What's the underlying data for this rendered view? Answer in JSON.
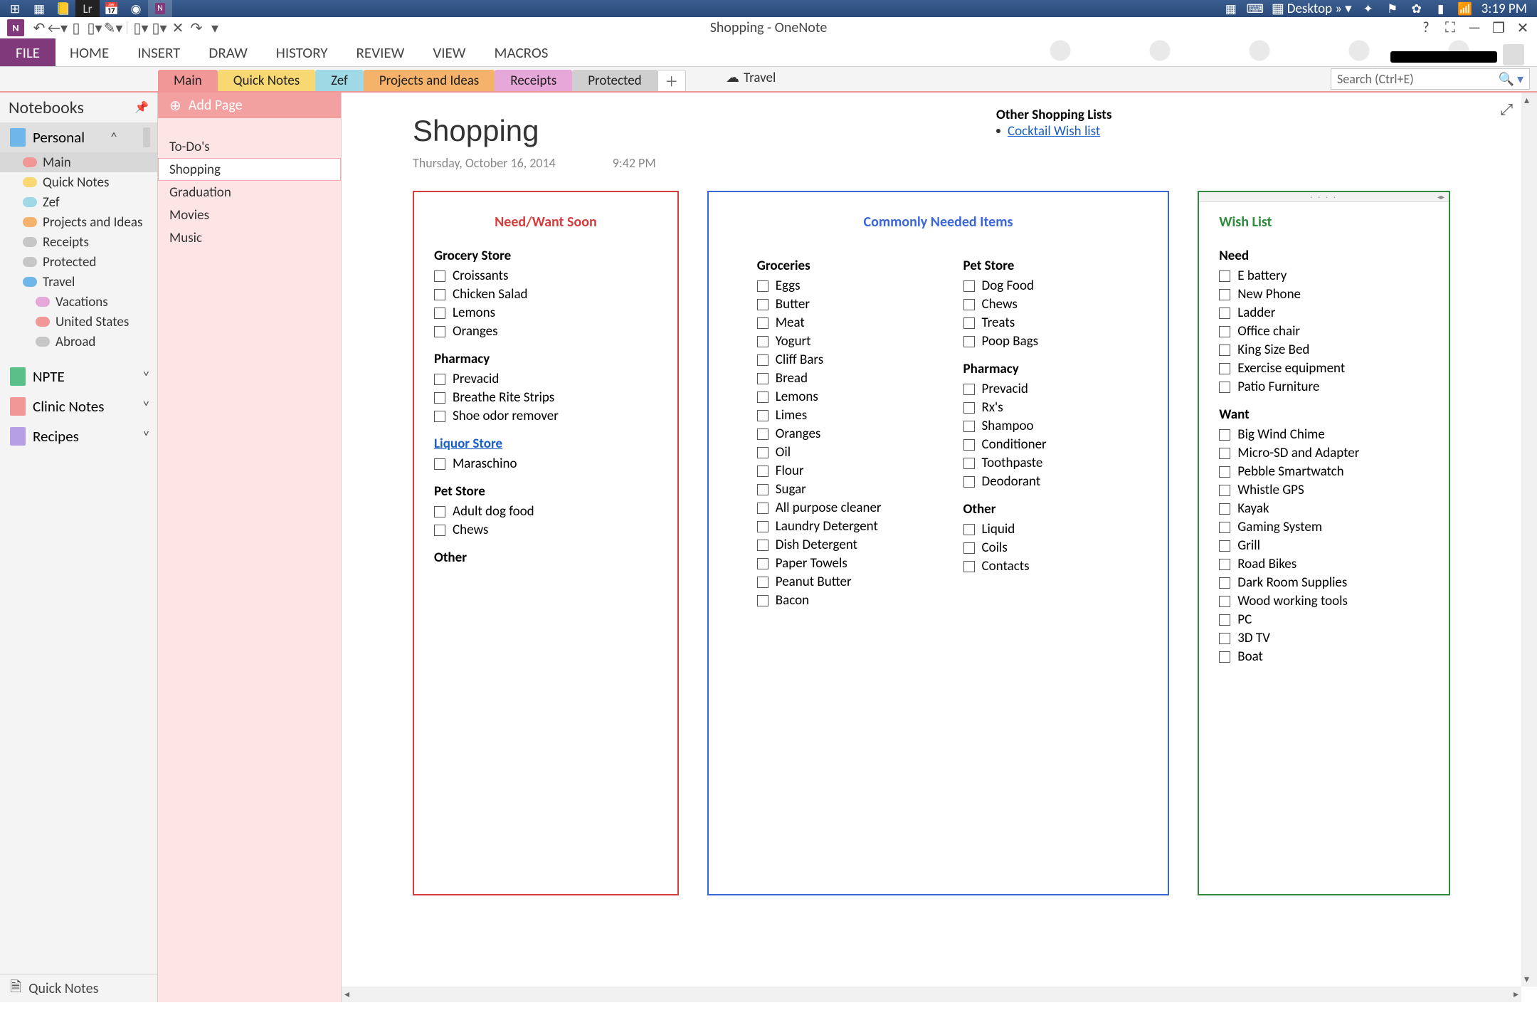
{
  "taskbar": {
    "desktop_label": "Desktop",
    "time": "3:19 PM"
  },
  "window": {
    "title": "Shopping - OneNote"
  },
  "ribbon": {
    "file": "FILE",
    "tabs": [
      "HOME",
      "INSERT",
      "DRAW",
      "HISTORY",
      "REVIEW",
      "VIEW",
      "MACROS"
    ]
  },
  "section_tabs": [
    {
      "label": "Main",
      "color": "#f29797"
    },
    {
      "label": "Quick Notes",
      "color": "#f7d873"
    },
    {
      "label": "Zef",
      "color": "#9fd9e6"
    },
    {
      "label": "Projects and Ideas",
      "color": "#f4b26b"
    },
    {
      "label": "Receipts",
      "color": "#e6a8d8"
    },
    {
      "label": "Protected",
      "color": "#cfcfcf"
    }
  ],
  "section_group_link": "Travel",
  "search": {
    "placeholder": "Search (Ctrl+E)"
  },
  "notebooks": {
    "header": "Notebooks",
    "books": [
      {
        "label": "Personal",
        "color": "#6fb7e8",
        "expanded": true,
        "selected": true,
        "sections": [
          {
            "label": "Main",
            "color": "#f29797",
            "selected": true
          },
          {
            "label": "Quick Notes",
            "color": "#f7d873"
          },
          {
            "label": "Zef",
            "color": "#9fd9e6"
          },
          {
            "label": "Projects and Ideas",
            "color": "#f4b26b"
          },
          {
            "label": "Receipts",
            "color": "#c6c6c6"
          },
          {
            "label": "Protected",
            "color": "#c6c6c6"
          },
          {
            "label": "Travel",
            "color": "#6fb7e8",
            "group": true
          },
          {
            "label": "Vacations",
            "color": "#e6a8d8",
            "sub": true
          },
          {
            "label": "United States",
            "color": "#f29797",
            "sub": true
          },
          {
            "label": "Abroad",
            "color": "#c6c6c6",
            "sub": true
          }
        ]
      },
      {
        "label": "NPTE",
        "color": "#5bbf8a"
      },
      {
        "label": "Clinic Notes",
        "color": "#f29797"
      },
      {
        "label": "Recipes",
        "color": "#b79fe6"
      }
    ],
    "footer": "Quick Notes"
  },
  "pages": {
    "add_label": "Add Page",
    "items": [
      "To-Do's",
      "Shopping",
      "Graduation",
      "Movies",
      "Music"
    ],
    "selected": "Shopping"
  },
  "page": {
    "title": "Shopping",
    "date": "Thursday, October 16, 2014",
    "time": "9:42 PM"
  },
  "other_lists": {
    "header": "Other Shopping Lists",
    "link": "Cocktail Wish list"
  },
  "box_red": {
    "title": "Need/Want Soon",
    "groups": [
      {
        "cat": "Grocery Store",
        "items": [
          "Croissants",
          "Chicken Salad",
          "Lemons",
          "Oranges"
        ]
      },
      {
        "cat": "Pharmacy",
        "items": [
          "Prevacid",
          "Breathe Rite Strips",
          "Shoe odor remover"
        ]
      },
      {
        "cat": "Liquor Store",
        "link": true,
        "items": [
          "Maraschino"
        ]
      },
      {
        "cat": "Pet Store",
        "items": [
          "Adult dog food",
          "Chews"
        ]
      },
      {
        "cat": "Other",
        "items": []
      }
    ]
  },
  "box_blue": {
    "title": "Commonly Needed Items",
    "left": [
      {
        "cat": "Groceries",
        "items": [
          "Eggs",
          "Butter",
          "Meat",
          "Yogurt",
          "Cliff Bars",
          "Bread",
          "Lemons",
          "Limes",
          "Oranges",
          "Oil",
          "Flour",
          "Sugar",
          "All purpose cleaner",
          "Laundry Detergent",
          "Dish Detergent",
          "Paper Towels",
          "Peanut Butter",
          "Bacon"
        ]
      }
    ],
    "right": [
      {
        "cat": "Pet Store",
        "items": [
          "Dog Food",
          "Chews",
          "Treats",
          "Poop Bags"
        ]
      },
      {
        "cat": "Pharmacy",
        "items": [
          "Prevacid",
          "Rx's",
          "Shampoo",
          "Conditioner",
          "Toothpaste",
          "Deodorant"
        ]
      },
      {
        "cat": "Other",
        "items": [
          "Liquid",
          "Coils",
          "Contacts"
        ]
      }
    ]
  },
  "box_green": {
    "title": "Wish List",
    "groups": [
      {
        "cat": "Need",
        "items": [
          "E battery",
          "New Phone",
          "Ladder",
          "Office chair",
          "King Size Bed",
          "Exercise equipment",
          "Patio Furniture"
        ]
      },
      {
        "cat": "Want",
        "items": [
          "Big Wind Chime",
          "Micro-SD and Adapter",
          "Pebble Smartwatch",
          "Whistle GPS",
          "Kayak",
          "Gaming System",
          "Grill",
          "Road Bikes",
          "Dark Room Supplies",
          "Wood working tools",
          "PC",
          "3D TV",
          "Boat"
        ]
      }
    ]
  }
}
